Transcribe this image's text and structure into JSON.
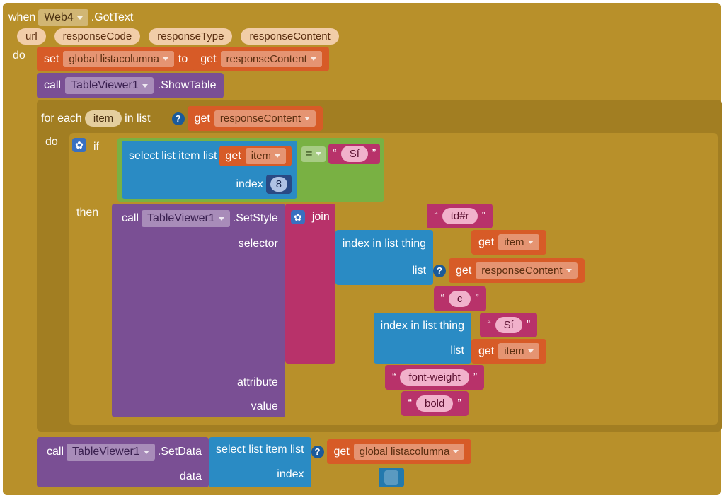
{
  "event": {
    "when": "when",
    "component": "Web4",
    "method": ".GotText",
    "params": [
      "url",
      "responseCode",
      "responseType",
      "responseContent"
    ],
    "do": "do"
  },
  "setGlobal": {
    "set": "set",
    "var": "global listacolumna",
    "to": "to",
    "get": "get",
    "getvar": "responseContent"
  },
  "call1": {
    "call": "call",
    "component": "TableViewer1",
    "method": ".ShowTable"
  },
  "foreach": {
    "for": "for each",
    "item": "item",
    "inlist": "in list",
    "get": "get",
    "getvar": "responseContent",
    "do": "do"
  },
  "ifblock": {
    "if": "if",
    "then": "then"
  },
  "selectlist1": {
    "lbl": "select list item  list",
    "idx": "index",
    "get": "get",
    "item": "item",
    "idxval": "8"
  },
  "compare": {
    "eq": "=",
    "q1": "“",
    "q2": "”",
    "val": "Sí"
  },
  "call2": {
    "call": "call",
    "component": "TableViewer1",
    "method": ".SetStyle",
    "selector": "selector",
    "attribute": "attribute",
    "value": "value"
  },
  "join": {
    "join": "join",
    "p1": {
      "q1": "“",
      "val": "td#r",
      "q2": "”"
    },
    "p2": {
      "lbl": "index in list  thing",
      "list": "list",
      "get": "get",
      "item": "item",
      "get2": "get",
      "var2": "responseContent"
    },
    "p3": {
      "q1": "“",
      "val": "c",
      "q2": "”"
    },
    "p4": {
      "lbl": "index in list  thing",
      "list": "list",
      "q1": "“",
      "val": "Sí",
      "q2": "”",
      "get": "get",
      "item": "item"
    }
  },
  "attr": {
    "q1": "“",
    "val": "font-weight",
    "q2": "”"
  },
  "valpill": {
    "q1": "“",
    "val": "bold",
    "q2": "”"
  },
  "call3": {
    "call": "call",
    "component": "TableViewer1",
    "method": ".SetData",
    "data": "data"
  },
  "selectlist2": {
    "lbl": "select list item  list",
    "idx": "index",
    "get": "get",
    "var": "global listacolumna"
  }
}
